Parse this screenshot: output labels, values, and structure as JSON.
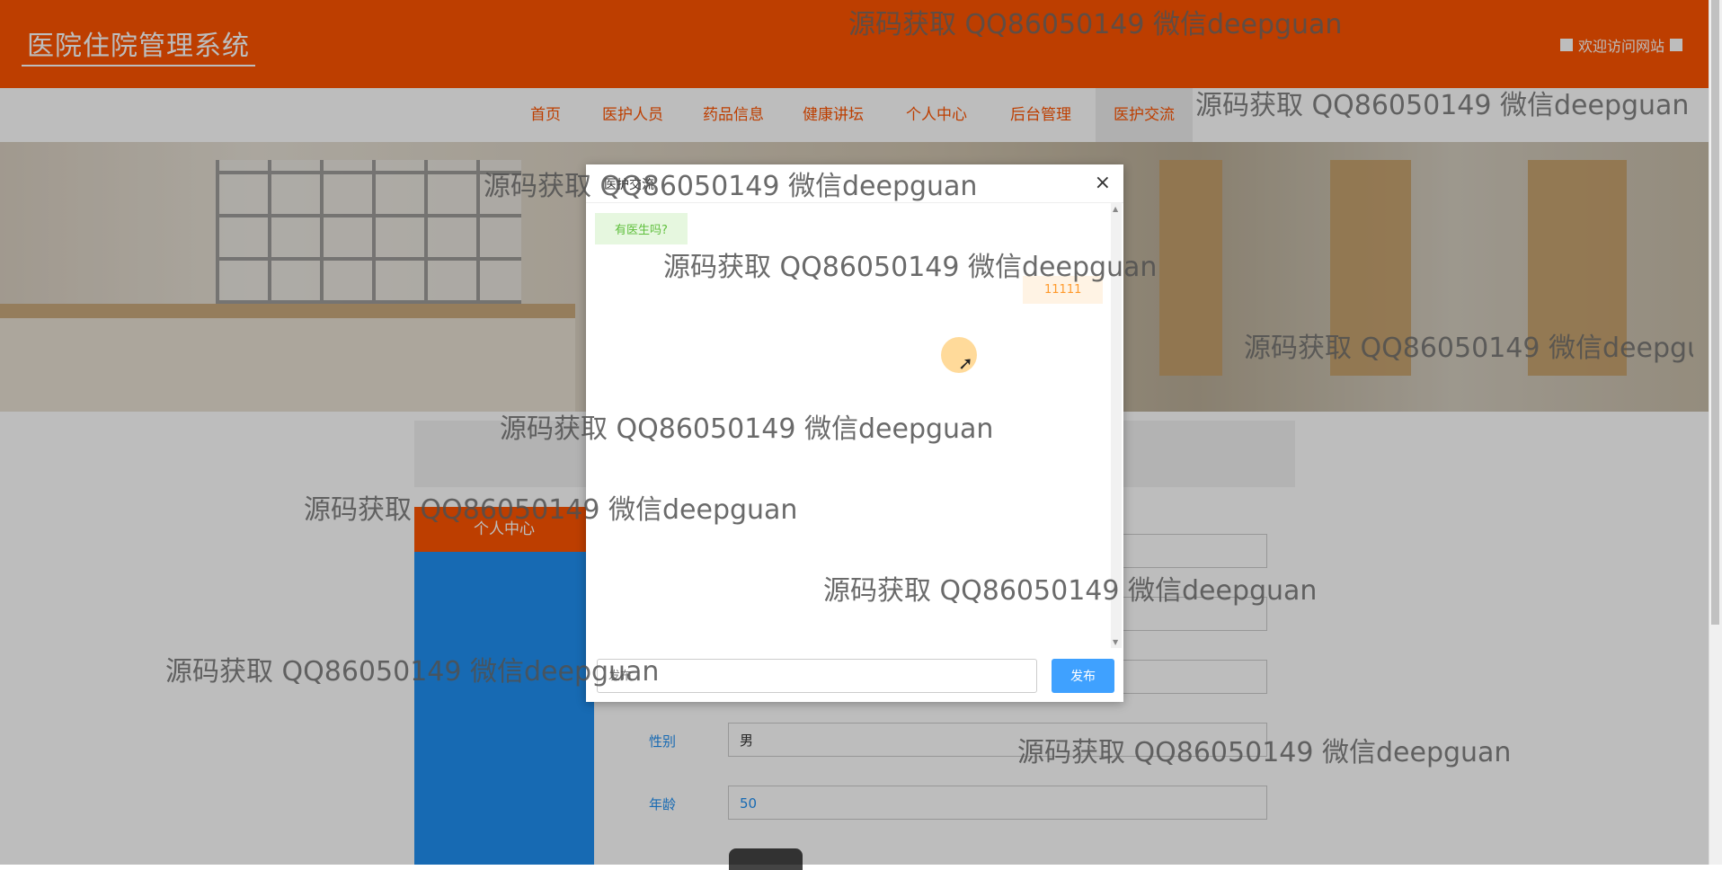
{
  "header": {
    "site_title": "医院住院管理系统",
    "welcome": "欢迎访问网站"
  },
  "nav": {
    "items": [
      {
        "label": "首页"
      },
      {
        "label": "医护人员"
      },
      {
        "label": "药品信息"
      },
      {
        "label": "健康讲坛"
      },
      {
        "label": "个人中心"
      },
      {
        "label": "后台管理"
      },
      {
        "label": "医护交流",
        "active": true
      }
    ]
  },
  "sidebar": {
    "heading": "个人中心"
  },
  "form": {
    "fields": [
      {
        "label": "性别",
        "value": "男"
      },
      {
        "label": "年龄",
        "value": "50"
      }
    ]
  },
  "modal": {
    "title": "医护交流",
    "close_icon": "close-icon",
    "messages": [
      {
        "side": "left",
        "text": "有医生吗?"
      },
      {
        "side": "right",
        "text": "11111"
      }
    ],
    "input_placeholder": "发布",
    "send_label": "发布"
  },
  "watermark": {
    "text": "源码获取 QQ86050149 微信deepguan"
  },
  "colors": {
    "brand": "#ff5400",
    "accent": "#1f8ff2",
    "send_button": "#3fa1ff"
  }
}
